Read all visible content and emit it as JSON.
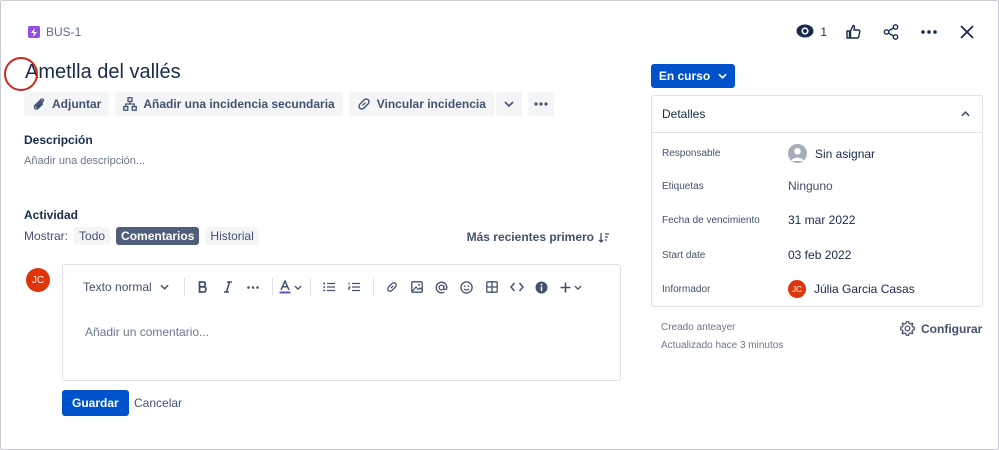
{
  "header": {
    "issue_key": "BUS-1",
    "watch_count": "1"
  },
  "issue": {
    "title": "Ametlla del vallés"
  },
  "toolbar": {
    "attach_label": "Adjuntar",
    "add_child_label": "Añadir una incidencia secundaria",
    "link_label": "Vincular incidencia"
  },
  "description": {
    "label": "Descripción",
    "placeholder": "Añadir una descripción..."
  },
  "activity": {
    "label": "Actividad",
    "show_label": "Mostrar:",
    "filters": [
      "Todo",
      "Comentarios",
      "Historial"
    ],
    "active_filter": "Comentarios",
    "sort_label": "Más recientes primero"
  },
  "comment": {
    "avatar_initials": "JC",
    "format_label": "Texto normal",
    "placeholder": "Añadir un comentario...",
    "save_label": "Guardar",
    "cancel_label": "Cancelar"
  },
  "status": {
    "label": "En curso"
  },
  "details": {
    "title": "Detalles",
    "fields": [
      {
        "key": "Responsable",
        "value": "Sin asignar"
      },
      {
        "key": "Etiquetas",
        "value": "Ninguno"
      },
      {
        "key": "Fecha de vencimiento",
        "value": "31 mar 2022"
      },
      {
        "key": "Start date",
        "value": "03 feb 2022"
      },
      {
        "key": "Informador",
        "value": "Júlia Garcia Casas",
        "initials": "JC"
      }
    ]
  },
  "meta": {
    "created": "Creado anteayer",
    "updated": "Actualizado hace 3 minutos",
    "configure_label": "Configurar"
  },
  "colors": {
    "primary": "#0052cc",
    "annotation": "#d0271d",
    "avatar": "#de350b",
    "epic": "#904ee2"
  }
}
